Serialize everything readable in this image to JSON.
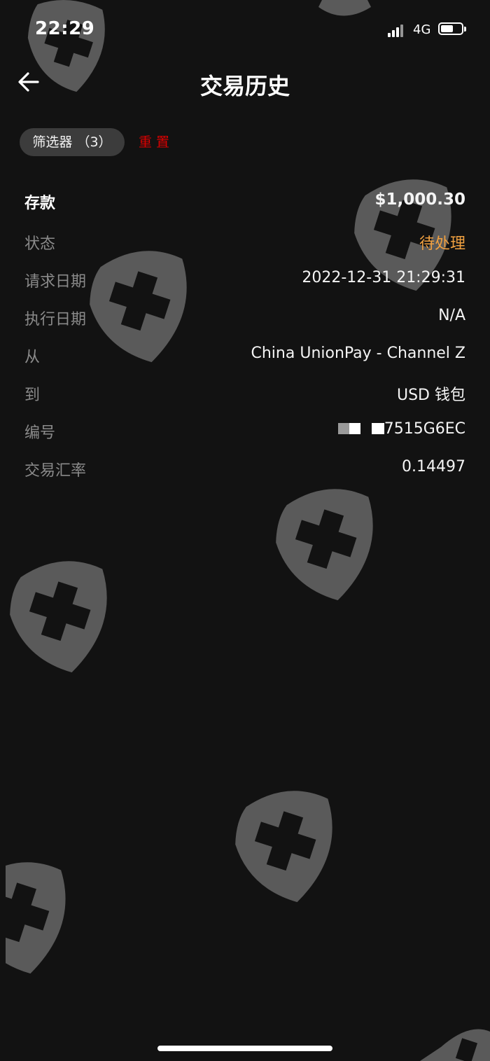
{
  "status_bar": {
    "time": "22:29",
    "network": "4G",
    "battery_level": 0.6
  },
  "header": {
    "title": "交易历史",
    "back_icon": "arrow-left-icon"
  },
  "filter": {
    "chip_label": "筛选器 （3）",
    "reset_label": "重置"
  },
  "transaction": {
    "type_label": "存款",
    "amount": "$1,000.30",
    "rows": [
      {
        "label": "状态",
        "value": "待处理",
        "status": "pending"
      },
      {
        "label": "请求日期",
        "value": "2022-12-31 21:29:31"
      },
      {
        "label": "执行日期",
        "value": "N/A"
      },
      {
        "label": "从",
        "value": "China UnionPay - Channel Z"
      },
      {
        "label": "到",
        "value": "USD 钱包"
      },
      {
        "label": "编号",
        "value": "7515G6EC",
        "redacted_prefix": true
      },
      {
        "label": "交易汇率",
        "value": "0.14497"
      }
    ]
  },
  "colors": {
    "background": "#121212",
    "accent_reset": "#d90000",
    "status_pending": "#f0a040",
    "watermark": "#5a5a5a"
  }
}
